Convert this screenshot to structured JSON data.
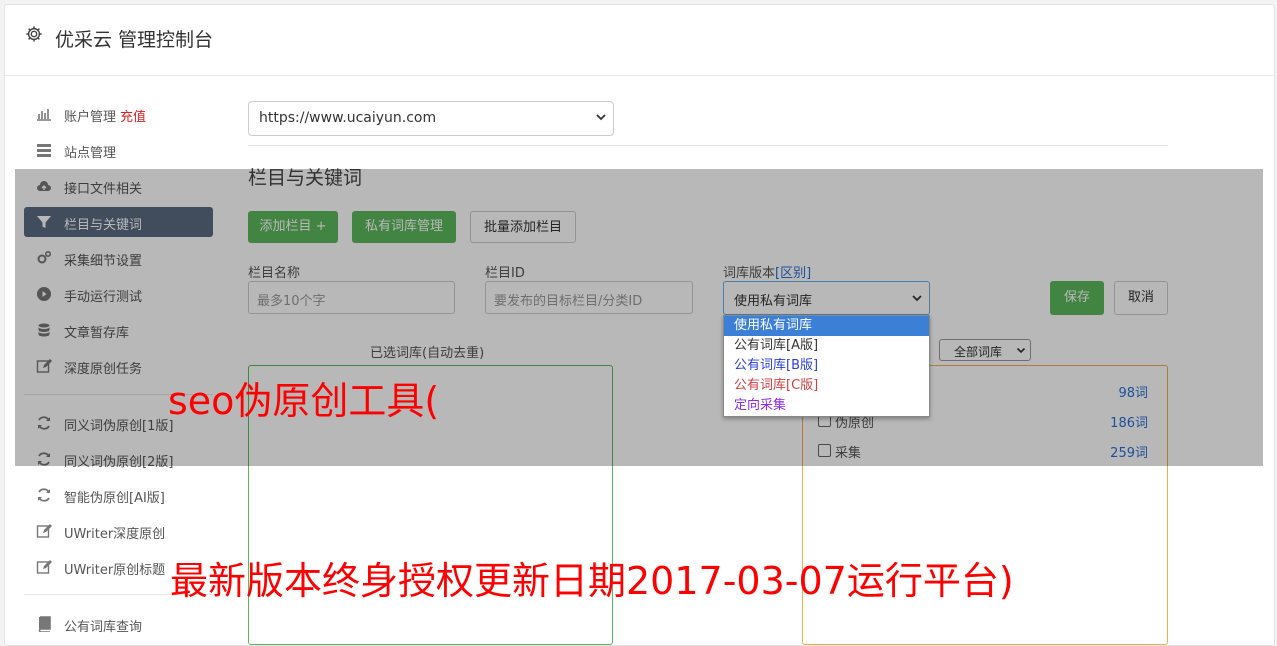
{
  "header": {
    "title": "优采云 管理控制台",
    "icon": "gear-icon"
  },
  "sidebar": {
    "items": [
      {
        "label": "账户管理",
        "badge": "充值",
        "icon": "bar-chart-icon"
      },
      {
        "label": "站点管理",
        "icon": "server-icon"
      },
      {
        "label": "接口文件相关",
        "icon": "cloud-upload-icon"
      },
      {
        "label": "栏目与关键词",
        "icon": "filter-icon"
      },
      {
        "label": "采集细节设置",
        "icon": "cogs-icon"
      },
      {
        "label": "手动运行测试",
        "icon": "play-circle-icon"
      },
      {
        "label": "文章暂存库",
        "icon": "database-icon"
      },
      {
        "label": "深度原创任务",
        "icon": "edit-icon"
      },
      {
        "label": "同义词伪原创[1版]",
        "icon": "refresh-icon"
      },
      {
        "label": "同义词伪原创[2版]",
        "icon": "refresh-icon"
      },
      {
        "label": "智能伪原创[AI版]",
        "icon": "refresh-icon"
      },
      {
        "label": "UWriter深度原创",
        "icon": "edit-icon"
      },
      {
        "label": "UWriter原创标题",
        "icon": "edit-icon"
      },
      {
        "label": "公有词库查询",
        "icon": "book-icon"
      }
    ]
  },
  "main": {
    "site_select": "https://www.ucaiyun.com",
    "section_title": "栏目与关键词",
    "buttons": {
      "add_column": "添加栏目 +",
      "private_lib": "私有词库管理",
      "batch_add": "批量添加栏目",
      "save": "保存",
      "cancel": "取消"
    },
    "form": {
      "name_label": "栏目名称",
      "name_placeholder": "最多10个字",
      "id_label": "栏目ID",
      "id_placeholder": "要发布的目标栏目/分类ID",
      "version_label": "词库版本",
      "version_link": "[区别]",
      "version_value": "使用私有词库"
    },
    "version_options": [
      "使用私有词库",
      "公有词库[A版]",
      "公有词库[B版]",
      "公有词库[C版]",
      "定向采集"
    ],
    "selected_label": "已选词库(自动去重)",
    "filter_select": "全部词库",
    "libraries": [
      {
        "name": "",
        "count": "98词"
      },
      {
        "name": "伪原创",
        "count": "186词"
      },
      {
        "name": "采集",
        "count": "259词"
      }
    ],
    "option_colors": {
      "a": "#333333",
      "b": "#2a3fd6",
      "c": "#d04040",
      "d": "#8a2be2"
    }
  },
  "watermark": {
    "line1": "seo伪原创工具(",
    "line2": "最新版本终身授权更新日期2017-03-07运行平台)"
  }
}
